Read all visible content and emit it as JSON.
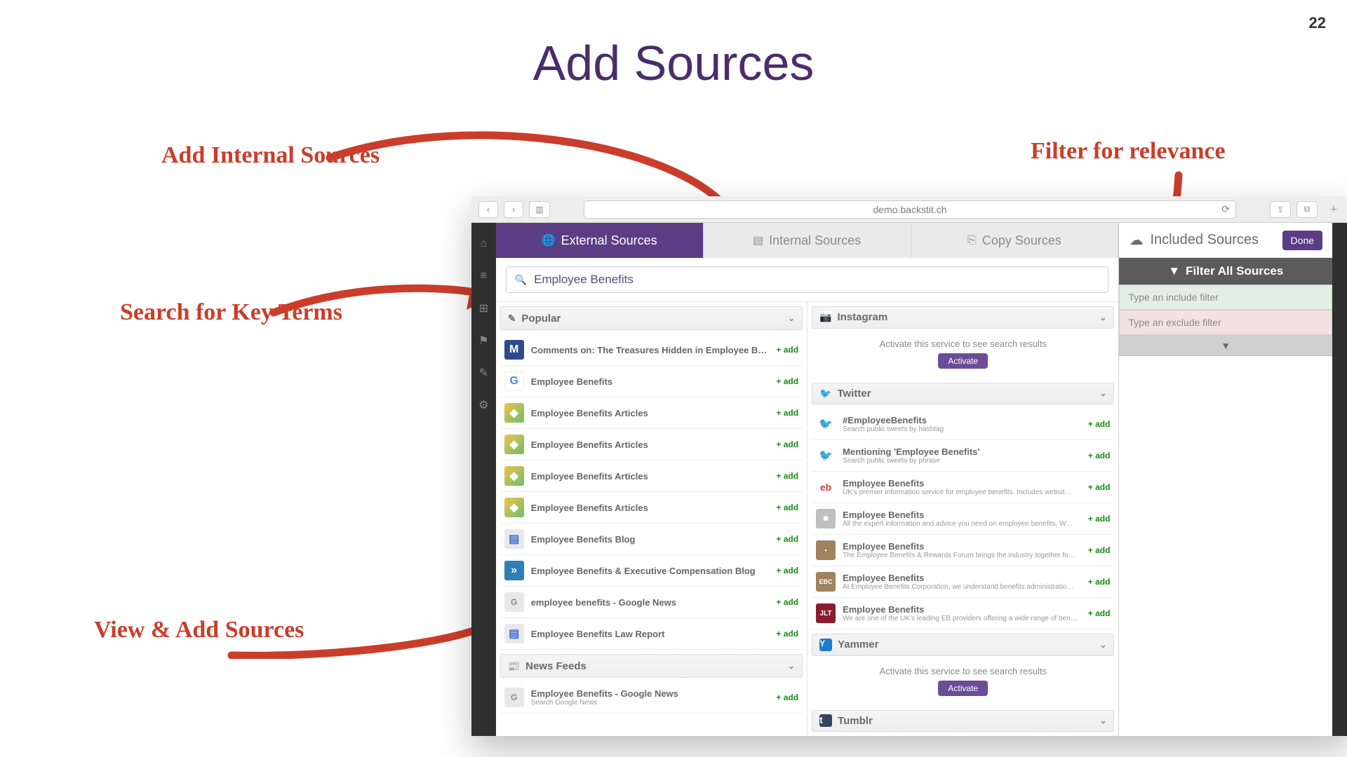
{
  "page_number": "22",
  "slide_title": "Add Sources",
  "annotations": {
    "add_internal": "Add Internal Sources",
    "filter_relevance": "Filter for relevance",
    "search_terms": "Search for Key Terms",
    "view_add": "View & Add Sources"
  },
  "browser": {
    "url": "demo.backstit.ch"
  },
  "tabs": {
    "external": "External Sources",
    "internal": "Internal Sources",
    "copy": "Copy Sources"
  },
  "search": {
    "value": "Employee Benefits"
  },
  "add_label": "+ add",
  "activate_msg": "Activate this service to see search results",
  "activate_btn": "Activate",
  "col1": {
    "section1": "Popular",
    "items": [
      {
        "title": "Comments on: The Treasures Hidden in Employee Benefits",
        "icon": "M",
        "cls": "bg-m"
      },
      {
        "title": "Employee Benefits",
        "icon": "G",
        "cls": "bg-g"
      },
      {
        "title": "Employee Benefits Articles",
        "icon": "◆",
        "cls": "bg-dia"
      },
      {
        "title": "Employee Benefits Articles",
        "icon": "◆",
        "cls": "bg-dia"
      },
      {
        "title": "Employee Benefits Articles",
        "icon": "◆",
        "cls": "bg-dia"
      },
      {
        "title": "Employee Benefits Articles",
        "icon": "◆",
        "cls": "bg-dia"
      },
      {
        "title": "Employee Benefits Blog",
        "icon": "▤",
        "cls": "bg-doc"
      },
      {
        "title": "Employee Benefits & Executive Compensation Blog",
        "icon": "»",
        "cls": "bg-arr"
      },
      {
        "title": "employee benefits - Google News",
        "icon": "G",
        "cls": "bg-news"
      },
      {
        "title": "Employee Benefits Law Report",
        "icon": "▤",
        "cls": "bg-doc"
      }
    ],
    "section2": "News Feeds",
    "items2": [
      {
        "title": "Employee Benefits - Google News",
        "sub": "Search Google News",
        "icon": "G",
        "cls": "bg-news"
      }
    ]
  },
  "col2": {
    "instagram": "Instagram",
    "twitter": "Twitter",
    "yammer": "Yammer",
    "tumblr": "Tumblr",
    "tw_items": [
      {
        "title": "#EmployeeBenefits",
        "sub": "Search public tweets by hashtag",
        "icon": "🐦",
        "cls": "bg-tw"
      },
      {
        "title": "Mentioning 'Employee Benefits'",
        "sub": "Search public tweets by phrase",
        "icon": "🐦",
        "cls": "bg-tw"
      },
      {
        "title": "Employee Benefits",
        "sub": "UK's premier information service for employee benefits. Includes websit…",
        "icon": "eb",
        "cls": "bg-eb"
      },
      {
        "title": "Employee Benefits",
        "sub": "All the expert information and advice you need on employee benefits. W…",
        "icon": "●",
        "cls": "bg-grey"
      },
      {
        "title": "Employee Benefits",
        "sub": "The Employee Benefits & Rewards Forum brings the industry together fo…",
        "icon": "▪",
        "cls": "bg-brown"
      },
      {
        "title": "Employee Benefits",
        "sub": "At Employee Benefits Corporation, we understand benefits administratio…",
        "icon": "EBC",
        "cls": "bg-brown"
      },
      {
        "title": "Employee Benefits",
        "sub": "We are one of the UK's leading EB providers offering a wide range of ben…",
        "icon": "JLT",
        "cls": "bg-jlt"
      }
    ]
  },
  "side": {
    "title": "Included Sources",
    "done": "Done",
    "filter_title": "Filter All Sources",
    "include_ph": "Type an include filter",
    "exclude_ph": "Type an exclude filter"
  }
}
